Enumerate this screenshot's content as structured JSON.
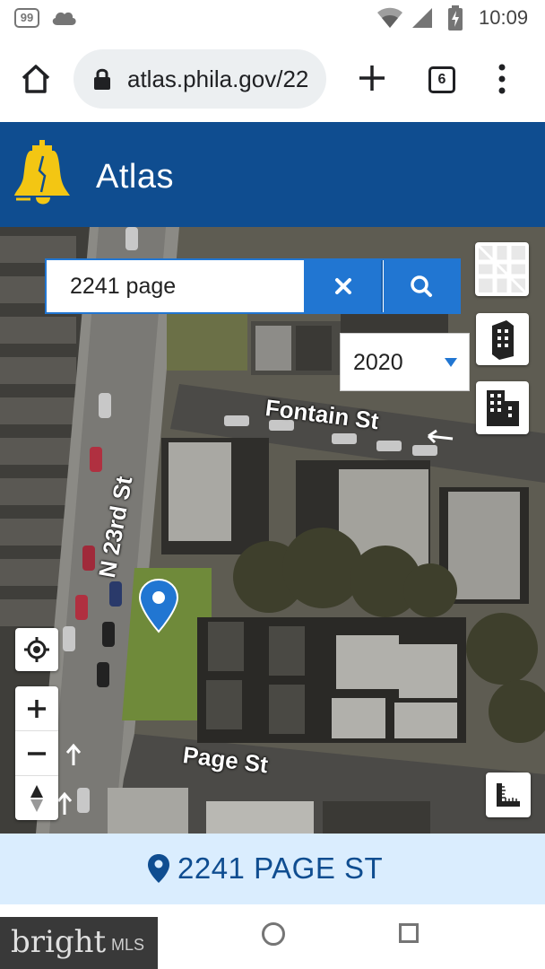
{
  "status_bar": {
    "notification_badge": "99",
    "time": "10:09",
    "icons": [
      "notification-badge-icon",
      "cloud-icon",
      "wifi-icon",
      "signal-icon",
      "battery-charging-icon"
    ]
  },
  "browser": {
    "url": "atlas.phila.gov/22",
    "tab_count": "6",
    "icons": [
      "home-icon",
      "lock-icon",
      "plus-icon",
      "tabs-icon",
      "more-vert-icon"
    ]
  },
  "app": {
    "title": "Atlas",
    "logo": "liberty-bell-logo"
  },
  "search": {
    "value": "2241 page",
    "icons": [
      "close-icon",
      "search-icon"
    ]
  },
  "map": {
    "imagery_year": "2020",
    "streets": {
      "fontain": "Fontain St",
      "n23rd": "N 23rd St",
      "page": "Page St"
    },
    "controls": {
      "zoom_in": "+",
      "zoom_out": "−"
    },
    "control_icons": [
      "basemap-icon",
      "imagery-icon",
      "buildings-icon",
      "locate-icon",
      "compass-icon",
      "measure-icon",
      "map-marker-icon"
    ]
  },
  "selected_address": {
    "label": "2241 PAGE ST"
  },
  "nav_bar": {
    "icons": [
      "nav-home-icon",
      "nav-recents-icon"
    ]
  },
  "watermark": {
    "brand": "bright",
    "suffix": "MLS"
  },
  "colors": {
    "header_blue": "#0f4d90",
    "action_blue": "#2176d2",
    "address_bar_bg": "#daedfe",
    "logo_gold": "#f3c613"
  }
}
